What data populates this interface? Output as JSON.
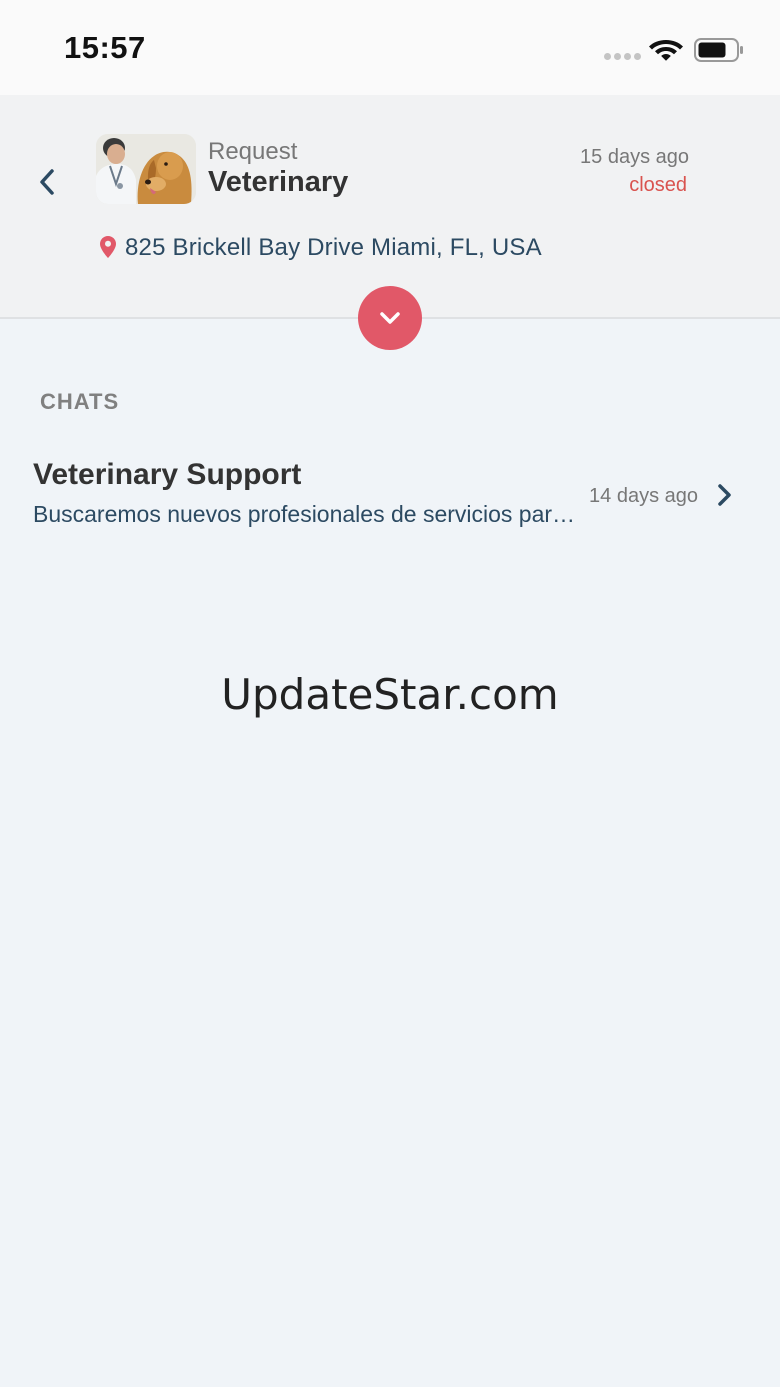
{
  "status_bar": {
    "time": "15:57"
  },
  "request": {
    "label": "Request",
    "title": "Veterinary",
    "age": "15 days ago",
    "status": "closed",
    "address": "825 Brickell Bay Drive Miami, FL, USA"
  },
  "chats": {
    "heading": "CHATS",
    "items": [
      {
        "title": "Veterinary Support",
        "preview": "Buscaremos nuevos profesionales de servicios para usted",
        "age": "14 days ago"
      }
    ]
  },
  "watermark": "UpdateStar.com",
  "colors": {
    "accent": "#e15868",
    "status_closed": "#d9534f",
    "text_dark_blue": "#2c4a62",
    "background": "#f0f4f8"
  },
  "icons": [
    "back-chevron-icon",
    "map-pin-icon",
    "chevron-down-icon",
    "chevron-right-icon",
    "wifi-icon",
    "battery-icon"
  ]
}
